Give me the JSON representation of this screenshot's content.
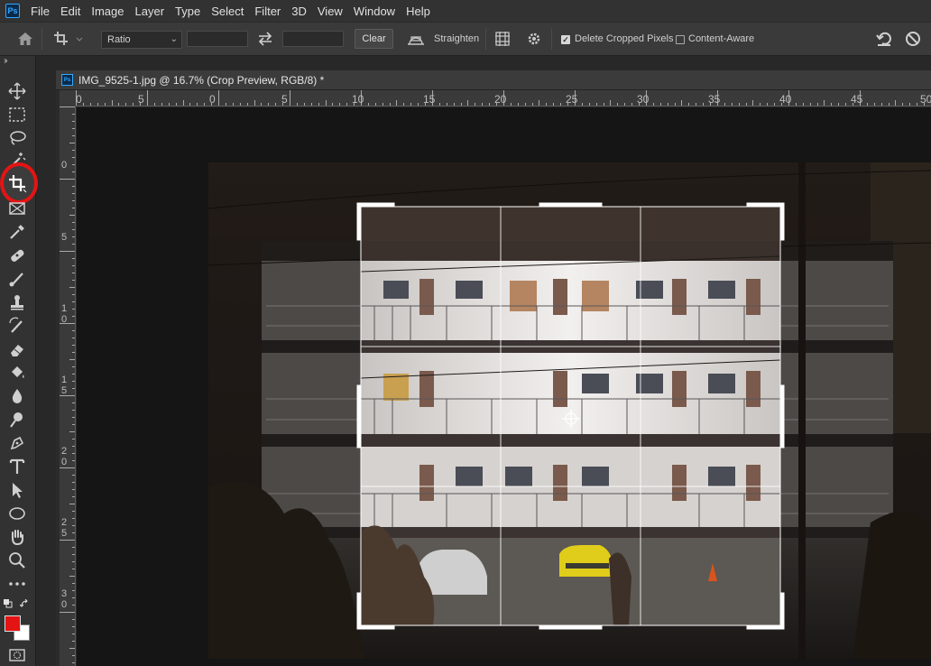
{
  "app": {
    "logo": "Ps",
    "menu": [
      "File",
      "Edit",
      "Image",
      "Layer",
      "Type",
      "Select",
      "Filter",
      "3D",
      "View",
      "Window",
      "Help"
    ]
  },
  "options_bar": {
    "home_icon": "home-icon",
    "crop_preset_icon": "crop-icon",
    "ratio_select": "Ratio",
    "width_value": "",
    "height_value": "",
    "swap_icon": "swap-icon",
    "clear_label": "Clear",
    "straighten_label": "Straighten",
    "delete_cropped_label": "Delete Cropped Pixels",
    "delete_cropped_checked": true,
    "content_aware_label": "Content-Aware",
    "content_aware_checked": false
  },
  "toolbar": {
    "tools": [
      "move",
      "marquee",
      "lasso",
      "magic-wand",
      "crop",
      "frame",
      "eyedropper",
      "healing",
      "brush",
      "stamp",
      "history-brush",
      "eraser",
      "paint-bucket",
      "blur",
      "dodge",
      "pen",
      "type",
      "path-select",
      "ellipse",
      "hand",
      "zoom",
      "more"
    ],
    "active_tool": "crop",
    "foreground_color": "#e41414",
    "background_color": "#ffffff"
  },
  "document": {
    "tab_icon": "Ps",
    "title": "IMG_9525-1.jpg @ 16.7% (Crop Preview, RGB/8) *",
    "ruler_h_labels": [
      "0",
      "5",
      "0",
      "5",
      "10",
      "15",
      "20",
      "25",
      "30",
      "35",
      "40",
      "45",
      "50"
    ],
    "ruler_v_labels": [
      "0",
      "5",
      "1\n0",
      "1\n5",
      "2\n0",
      "2\n5",
      "3\n0"
    ]
  }
}
